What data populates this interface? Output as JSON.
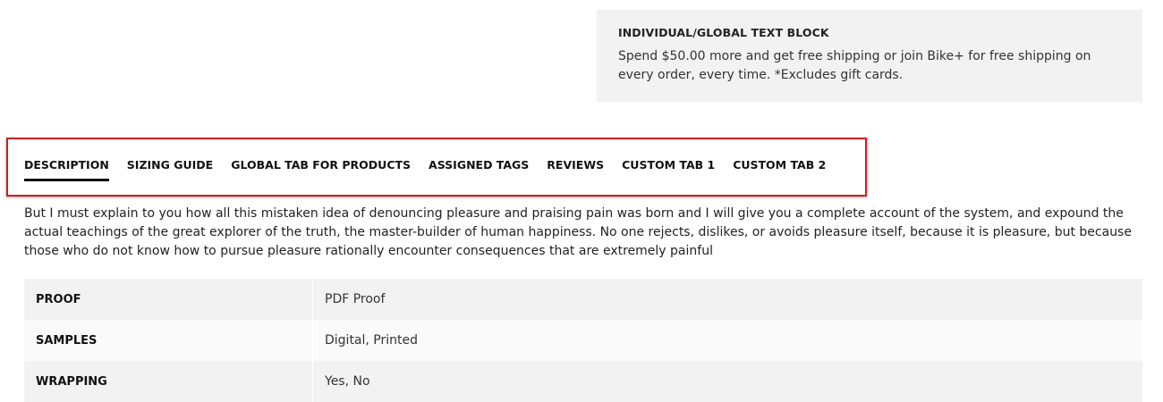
{
  "global_block": {
    "title": "INDIVIDUAL/GLOBAL TEXT BLOCK",
    "text": "Spend $50.00 more and get free shipping or join Bike+ for free shipping on every order, every time. *Excludes gift cards."
  },
  "tabs": [
    {
      "label": "DESCRIPTION",
      "active": true
    },
    {
      "label": "SIZING GUIDE",
      "active": false
    },
    {
      "label": "GLOBAL TAB FOR PRODUCTS",
      "active": false
    },
    {
      "label": "ASSIGNED TAGS",
      "active": false
    },
    {
      "label": "REVIEWS",
      "active": false
    },
    {
      "label": "CUSTOM TAB 1",
      "active": false
    },
    {
      "label": "CUSTOM TAB 2",
      "active": false
    }
  ],
  "description": "But I must explain to you how all this mistaken idea of denouncing pleasure and praising pain was born and I will give you a complete account of the system, and expound the actual teachings of the great explorer of the truth, the master-builder of human happiness. No one rejects, dislikes, or avoids pleasure itself, because it is pleasure, but because those who do not know how to pursue pleasure rationally encounter consequences that are extremely painful",
  "specs": [
    {
      "key": "PROOF",
      "value": "PDF Proof"
    },
    {
      "key": "SAMPLES",
      "value": "Digital, Printed"
    },
    {
      "key": "WRAPPING",
      "value": "Yes, No"
    }
  ],
  "colors": {
    "highlight_border": "#cc1f1f",
    "block_background": "#f2f2f2"
  }
}
